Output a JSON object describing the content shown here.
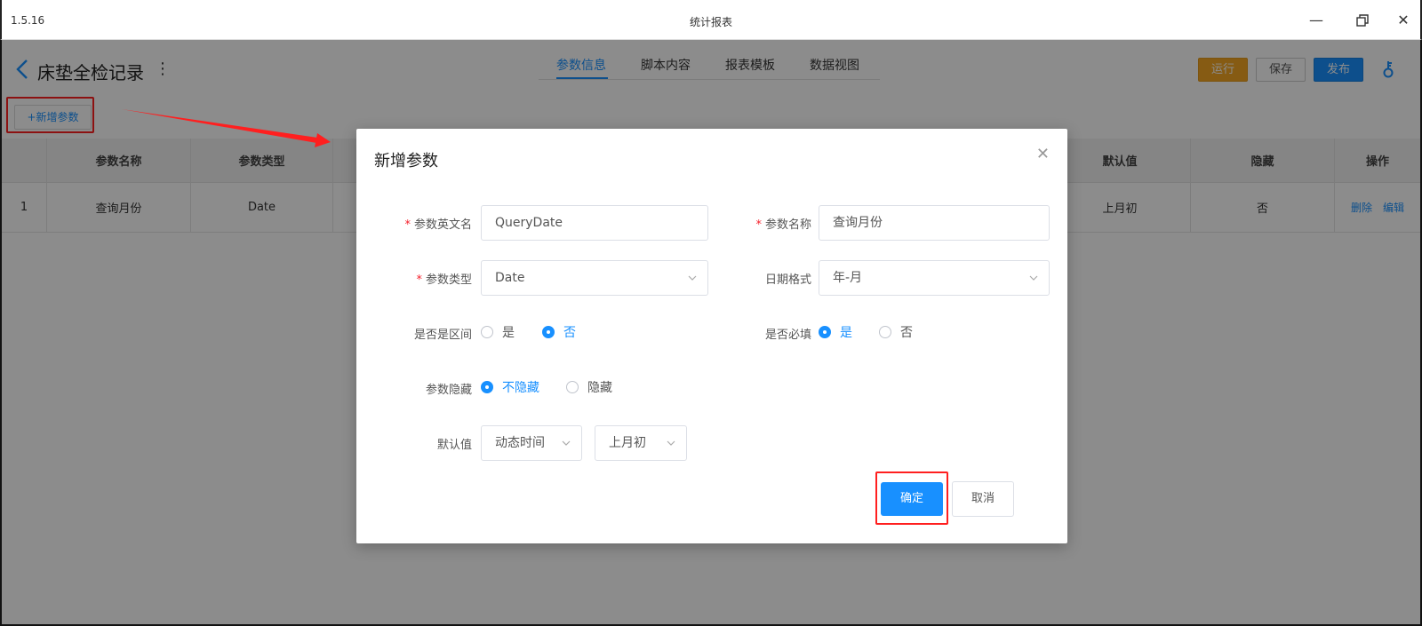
{
  "window": {
    "version": "1.5.16",
    "title": "统计报表"
  },
  "header": {
    "page_title": "床垫全检记录",
    "tabs": [
      {
        "label": "参数信息",
        "active": true
      },
      {
        "label": "脚本内容"
      },
      {
        "label": "报表模板"
      },
      {
        "label": "数据视图"
      }
    ],
    "buttons": {
      "run": "运行",
      "save": "保存",
      "publish": "发布"
    }
  },
  "add_param_label": "+新增参数",
  "table": {
    "headers": [
      "参数名称",
      "参数类型",
      "默认值",
      "隐藏",
      "操作"
    ],
    "rows": [
      {
        "index": "1",
        "name": "查询月份",
        "type": "Date",
        "default": "上月初",
        "hidden": "否",
        "ops": [
          "删除",
          "编辑"
        ]
      }
    ]
  },
  "modal": {
    "title": "新增参数",
    "fields": {
      "en_name": {
        "label": "参数英文名",
        "value": "QueryDate"
      },
      "name": {
        "label": "参数名称",
        "value": "查询月份"
      },
      "type": {
        "label": "参数类型",
        "value": "Date"
      },
      "date_format": {
        "label": "日期格式",
        "value": "年-月"
      },
      "is_range": {
        "label": "是否是区间",
        "options": [
          "是",
          "否"
        ],
        "selected": "否"
      },
      "required": {
        "label": "是否必填",
        "options": [
          "是",
          "否"
        ],
        "selected": "是"
      },
      "hidden": {
        "label": "参数隐藏",
        "options": [
          "不隐藏",
          "隐藏"
        ],
        "selected": "不隐藏"
      },
      "default": {
        "label": "默认值",
        "mode": "动态时间",
        "value": "上月初"
      }
    },
    "confirm": "确定",
    "cancel": "取消"
  },
  "colors": {
    "primary": "#1890ff",
    "run": "#f5a623",
    "highlight": "#ff1f1f"
  }
}
